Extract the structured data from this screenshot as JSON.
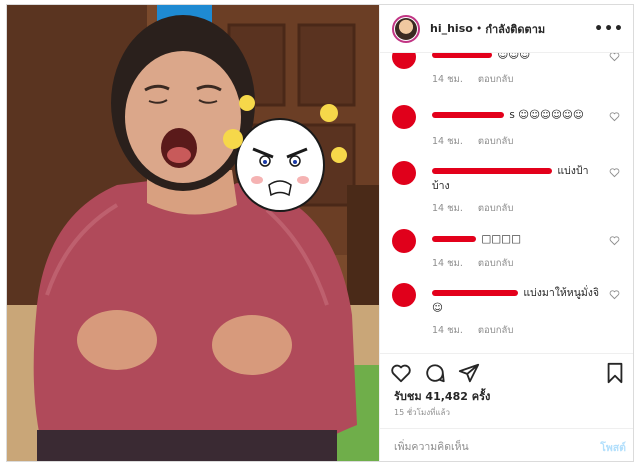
{
  "post": {
    "username": "hi_hiso",
    "separator": "•",
    "follow_status": "กำลังติดตาม",
    "more_icon": "more-horizontal-icon",
    "more_glyph": "•••"
  },
  "comments": [
    {
      "text": "☺☺☺",
      "time": "14 ชม.",
      "reply_label": "ตอบกลับ"
    },
    {
      "text": "s ☺☺☺☺☺☺",
      "time": "14 ชม.",
      "reply_label": "ตอบกลับ"
    },
    {
      "text": "แบ่งป้าบ้าง",
      "time": "14 ชม.",
      "reply_label": "ตอบกลับ"
    },
    {
      "text": "□□□□",
      "time": "14 ชม.",
      "reply_label": "ตอบกลับ"
    },
    {
      "text": "แบ่งมาให้หนูมั่งจิ☺",
      "time": "14 ชม.",
      "reply_label": "ตอบกลับ"
    }
  ],
  "actions": {
    "like_icon": "heart-icon",
    "comment_icon": "comment-bubble-icon",
    "share_icon": "paper-plane-icon",
    "save_icon": "bookmark-icon",
    "likes_text": "รับชม 41,482 ครั้ง",
    "time_text": "15 ชั่วโมงที่แล้ว"
  },
  "comment_form": {
    "placeholder": "เพิ่มความคิดเห็น",
    "post_label": "โพสต์"
  },
  "colors": {
    "redaction": "#e3001b",
    "accent_disabled": "#b2dffc",
    "muted": "#8e8e8e",
    "border": "#efefef"
  }
}
